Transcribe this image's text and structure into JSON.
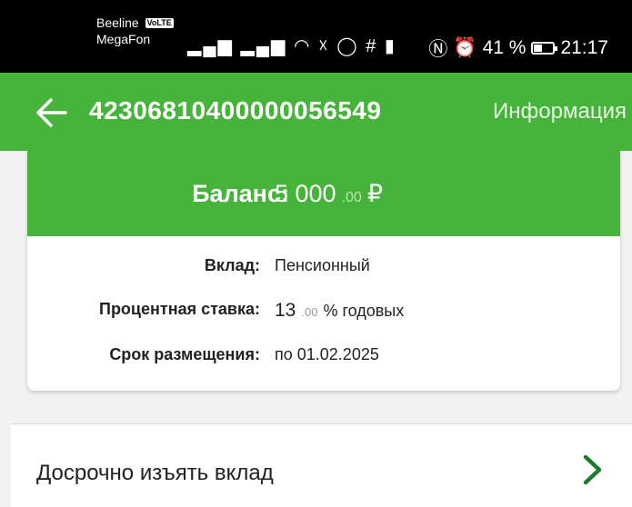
{
  "status_bar": {
    "carrier1": "Beeline",
    "volte": "VoLTE",
    "carrier2": "MegaFon",
    "battery_percent": "41 %",
    "battery_level": 0.41,
    "time": "21:17"
  },
  "header": {
    "title": "42306810400000056549",
    "info_link": "Информация"
  },
  "balance": {
    "label": "Баланс:",
    "whole": "5 000",
    "fraction": ".00",
    "currency": "₽"
  },
  "details": {
    "deposit_label": "Вклад:",
    "deposit_value": "Пенсионный",
    "rate_label": "Процентная ставка:",
    "rate_whole": "13",
    "rate_fraction": ".00",
    "rate_suffix": "% годовых",
    "term_label": "Срок размещения:",
    "term_value": "по 01.02.2025"
  },
  "actions": {
    "early_withdrawal": "Досрочно изъять вклад"
  },
  "colors": {
    "brand_green": "#46b43a",
    "chevron_green": "#1e7a2e"
  }
}
